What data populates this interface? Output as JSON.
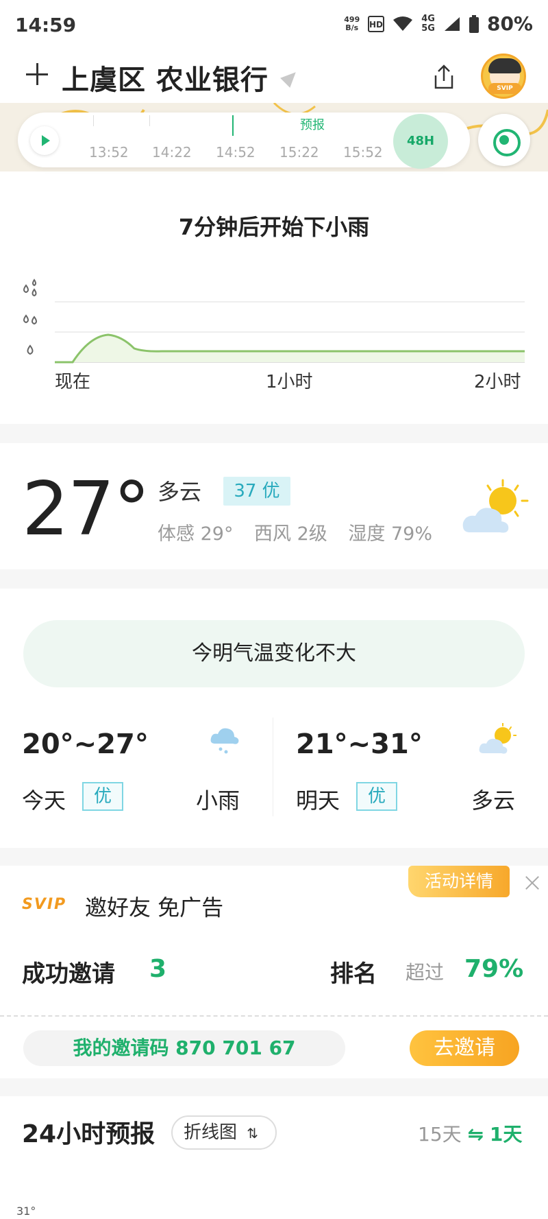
{
  "status_bar": {
    "time": "14:59",
    "net_speed_value": "499",
    "net_speed_unit": "B/s",
    "network_4g": "4G",
    "network_5g": "5G",
    "battery": "80%"
  },
  "header": {
    "location": "上虞区 农业银行"
  },
  "timeline": {
    "forecast_label": "预报",
    "ticks": [
      "13:52",
      "14:22",
      "14:52",
      "15:22",
      "15:52"
    ],
    "range_button": "48H"
  },
  "precip": {
    "title": "7分钟后开始下小雨",
    "axis_labels": [
      "现在",
      "1小时",
      "2小时"
    ]
  },
  "current": {
    "temperature": "27°",
    "condition": "多云",
    "aqi": "37 优",
    "feels_like": "体感 29°",
    "wind": "西风 2级",
    "humidity": "湿度 79%"
  },
  "today_tomorrow": {
    "banner": "今明气温变化不大",
    "today": {
      "temp_range": "20°~27°",
      "label": "今天",
      "aqi": "优",
      "condition": "小雨"
    },
    "tomorrow": {
      "temp_range": "21°~31°",
      "label": "明天",
      "aqi": "优",
      "condition": "多云"
    }
  },
  "invite": {
    "activity_button": "活动详情",
    "svip_logo": "SVIP",
    "title": "邀好友 免广告",
    "success_label": "成功邀请",
    "success_count": "3",
    "rank_label": "排名",
    "rank_prefix": "超过",
    "rank_value": "79%",
    "code_text": "我的邀请码 870 701 67",
    "invite_button": "去邀请"
  },
  "forecast24": {
    "title": "24小时预报",
    "view_toggle": "折线图",
    "switch_left": "15天",
    "switch_arrow": "⇋",
    "switch_right": "1天",
    "first_temp": "31°"
  },
  "colors": {
    "accent_green": "#21b573",
    "aqi_teal": "#28aabd",
    "svip_orange": "#f29a1f"
  }
}
